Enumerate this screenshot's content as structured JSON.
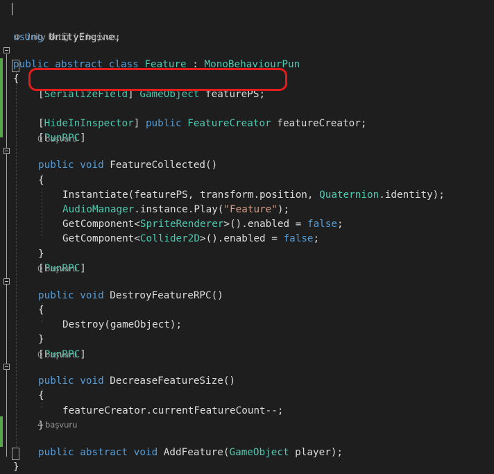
{
  "editor": {
    "code_lens": {
      "unity_script": "Unity Betiği | 6 başvuru",
      "zero_refs": "0 başvuru",
      "four_refs": "4 başvuru"
    },
    "lines": {
      "l1": [
        "using",
        "UnityEngine",
        ";"
      ],
      "l2": [
        "public",
        "abstract",
        "class",
        "Feature",
        ":",
        "MonoBehaviourPun"
      ],
      "l3": "{",
      "l4": [
        "[",
        "SerializeField",
        "] ",
        "GameObject",
        " featurePS;"
      ],
      "l5": [
        "[",
        "HideInInspector",
        "] ",
        "public",
        "FeatureCreator",
        " featureCreator;"
      ],
      "l6": [
        "[",
        "PunRPC",
        "]"
      ],
      "l7": [
        "public",
        "void",
        " FeatureCollected()"
      ],
      "l8": "{",
      "l9": [
        "Instantiate(featurePS, transform.position, ",
        "Quaternion",
        ".identity);"
      ],
      "l10": [
        "AudioManager",
        ".instance.Play(",
        "\"Feature\"",
        ");"
      ],
      "l11": [
        "GetComponent<",
        "SpriteRenderer",
        ">().enabled = ",
        "false",
        ";"
      ],
      "l12": [
        "GetComponent<",
        "Collider2D",
        ">().enabled = ",
        "false",
        ";"
      ],
      "l13": "}",
      "l14": [
        "[",
        "PunRPC",
        "]"
      ],
      "l15": [
        "public",
        "void",
        " DestroyFeatureRPC()"
      ],
      "l16": "{",
      "l17": "Destroy(gameObject);",
      "l18": "}",
      "l19": [
        "[",
        "PunRPC",
        "]"
      ],
      "l20": [
        "public",
        "void",
        " DecreaseFeatureSize()"
      ],
      "l21": "{",
      "l22": "featureCreator.currentFeatureCount--;",
      "l23": "}",
      "l24": [
        "public",
        "abstract",
        "void",
        " AddFeature(",
        "GameObject",
        " player);"
      ],
      "l25": "}"
    }
  },
  "colors": {
    "keyword": "#569cd6",
    "type": "#4ec9b0",
    "string": "#d69d85",
    "text": "#dcdcdc",
    "background": "#1e1e1e",
    "highlight_circle": "#e41c1c"
  }
}
